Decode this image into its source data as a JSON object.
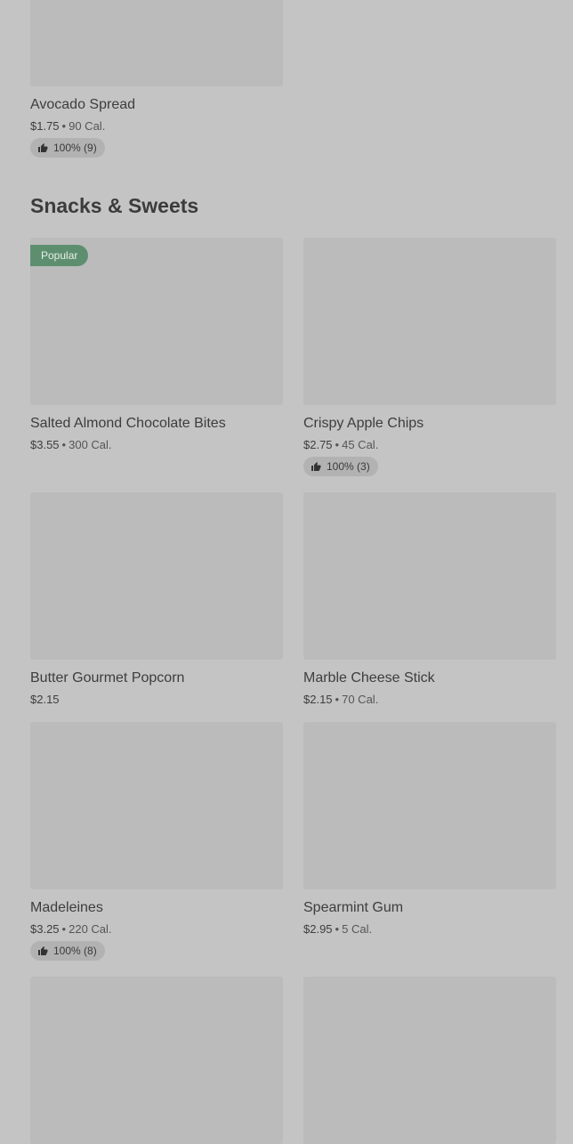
{
  "top_item": {
    "name": "Avocado Spread",
    "price": "$1.75",
    "calories": "90 Cal.",
    "rating": "100% (9)"
  },
  "section": {
    "title": "Snacks & Sweets"
  },
  "items": [
    {
      "name": "Salted Almond Chocolate Bites",
      "price": "$3.55",
      "calories": "300 Cal.",
      "badge": "Popular"
    },
    {
      "name": "Crispy Apple Chips",
      "price": "$2.75",
      "calories": "45 Cal.",
      "rating": "100% (3)"
    },
    {
      "name": "Butter Gourmet Popcorn",
      "price": "$2.15"
    },
    {
      "name": "Marble Cheese Stick",
      "price": "$2.15",
      "calories": "70 Cal."
    },
    {
      "name": "Madeleines",
      "price": "$3.25",
      "calories": "220 Cal.",
      "rating": "100% (8)"
    },
    {
      "name": "Spearmint Gum",
      "price": "$2.95",
      "calories": "5 Cal."
    }
  ],
  "colors": {
    "badge": "#5d8f6f",
    "background": "#c4c4c4",
    "thumb": "#bbbbbb"
  },
  "icons": {
    "rating": "thumbs-up-icon"
  }
}
